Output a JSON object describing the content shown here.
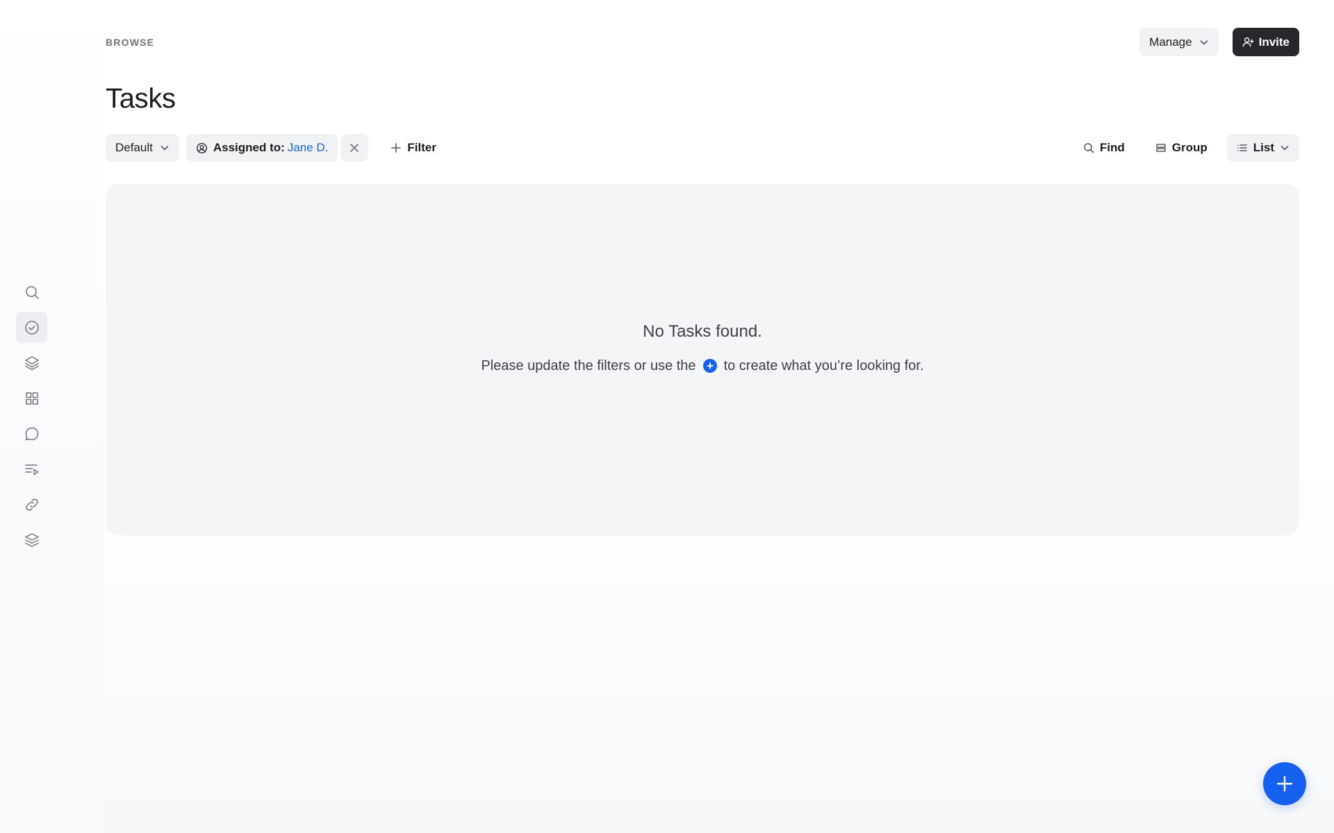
{
  "header": {
    "eyebrow": "BROWSE",
    "title": "Tasks",
    "manage_label": "Manage",
    "invite_label": "Invite"
  },
  "sidebar": {
    "items": [
      {
        "icon": "search-icon",
        "active": false
      },
      {
        "icon": "check-circle-icon",
        "active": true
      },
      {
        "icon": "layers-icon",
        "active": false
      },
      {
        "icon": "grid-icon",
        "active": false
      },
      {
        "icon": "chat-bubble-icon",
        "active": false
      },
      {
        "icon": "playlist-icon",
        "active": false
      },
      {
        "icon": "link-icon",
        "active": false
      },
      {
        "icon": "stack-icon",
        "active": false
      }
    ]
  },
  "toolbar": {
    "view_label": "Default",
    "filter_label": "Assigned to:",
    "filter_value": "Jane D.",
    "add_filter_label": "Filter",
    "find_label": "Find",
    "group_label": "Group",
    "layout_label": "List"
  },
  "empty_state": {
    "title": "No Tasks found.",
    "text_before": "Please update the filters or use the",
    "text_after": "to create what you’re looking for."
  },
  "colors": {
    "accent": "#1560ef",
    "link": "#1b63d6",
    "dark_button": "#26282b",
    "panel": "#f4f5f7"
  }
}
